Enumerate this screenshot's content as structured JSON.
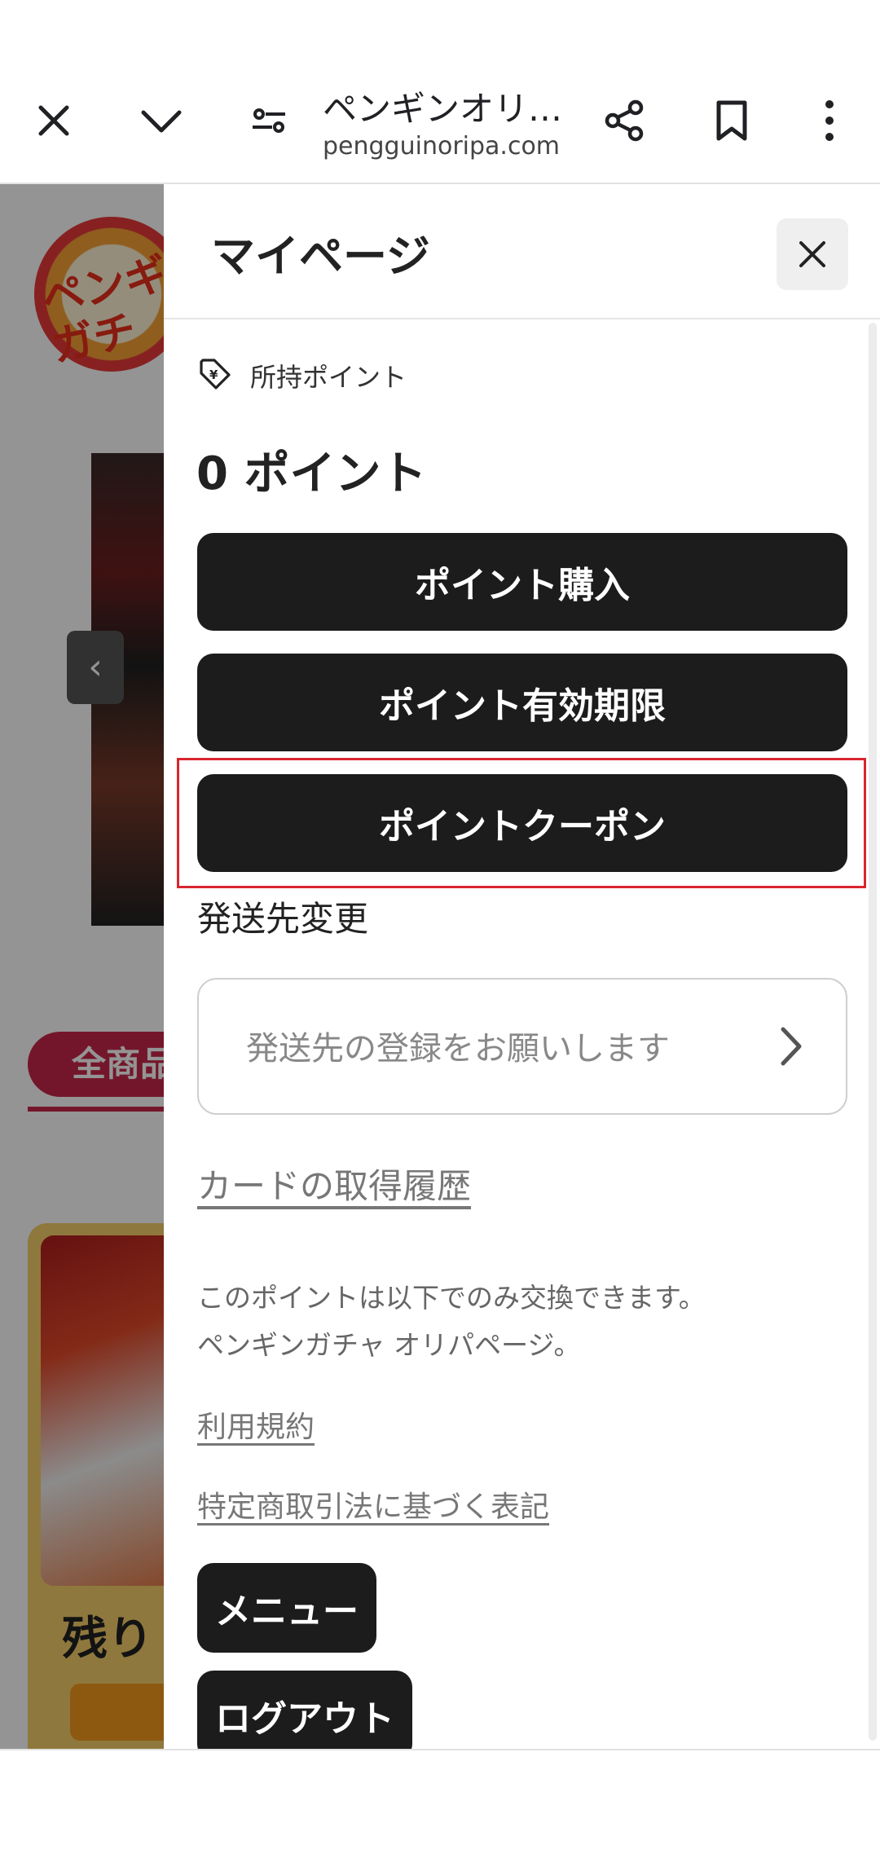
{
  "browser": {
    "title": "ペンギンオリ…",
    "url": "pengguinoripa.com",
    "icons": {
      "close": "close-icon",
      "collapse": "chevron-down-icon",
      "site_settings": "tune-icon",
      "share": "share-icon",
      "bookmark": "bookmark-icon",
      "more": "more-vert-icon"
    }
  },
  "background_page": {
    "logo_text": "ペンギン\nガチ",
    "banner_arrow": "‹",
    "category_pill": "全商品",
    "card_text": "残り"
  },
  "drawer": {
    "title": "マイページ",
    "close_icon": "close-icon",
    "points_label": "所持ポイント",
    "points_icon": "yen-tag-icon",
    "points_value": "0 ポイント",
    "buttons": {
      "purchase": "ポイント購入",
      "expiry": "ポイント有効期限",
      "coupon": "ポイントクーポン"
    },
    "shipping": {
      "section_title": "発送先変更",
      "placeholder": "発送先の登録をお願いします"
    },
    "card_history_link": "カードの取得履歴",
    "note_line1": "このポイントは以下でのみ交換できます。",
    "note_line2": "ペンギンガチャ オリパページ。",
    "terms_link": "利用規約",
    "law_link": "特定商取引法に基づく表記",
    "menu_button": "メニュー",
    "logout_button": "ログアウト"
  },
  "colors": {
    "button_bg": "#1c1c1c",
    "highlight": "#d9262f",
    "overlay": "rgba(0,0,0,0.42)"
  }
}
